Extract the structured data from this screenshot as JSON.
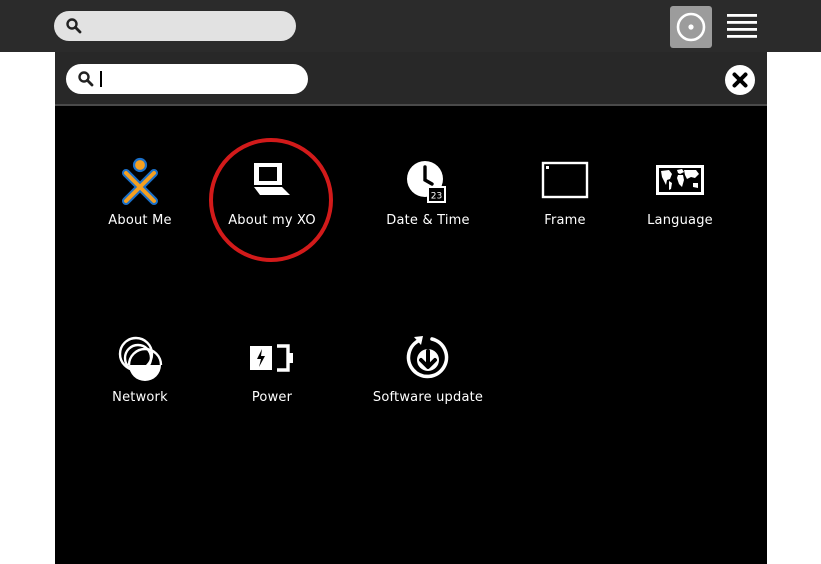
{
  "frame": {
    "search": {
      "placeholder": "",
      "icon": "search-icon"
    },
    "view_buttons": [
      {
        "name": "home-view",
        "icon": "home-ring-icon",
        "selected": true
      },
      {
        "name": "list-view",
        "icon": "list-icon",
        "selected": false
      }
    ]
  },
  "control_panel": {
    "search": {
      "value": "",
      "icon": "search-icon"
    },
    "close_icon": "close-icon",
    "highlight_color": "#d21a1a",
    "accent_colors": {
      "xo_stroke": "#1b70c9",
      "xo_fill": "#f5a021"
    },
    "items": [
      {
        "label": "About Me",
        "icon": "xo-person-icon"
      },
      {
        "label": "About my XO",
        "icon": "laptop-icon",
        "highlighted": true
      },
      {
        "label": "Date & Time",
        "icon": "clock-calendar-icon",
        "calendar_day": "23"
      },
      {
        "label": "Frame",
        "icon": "frame-icon"
      },
      {
        "label": "Language",
        "icon": "world-map-icon"
      },
      {
        "label": "Network",
        "icon": "network-icon"
      },
      {
        "label": "Power",
        "icon": "battery-icon"
      },
      {
        "label": "Software update",
        "icon": "software-update-icon"
      }
    ]
  }
}
